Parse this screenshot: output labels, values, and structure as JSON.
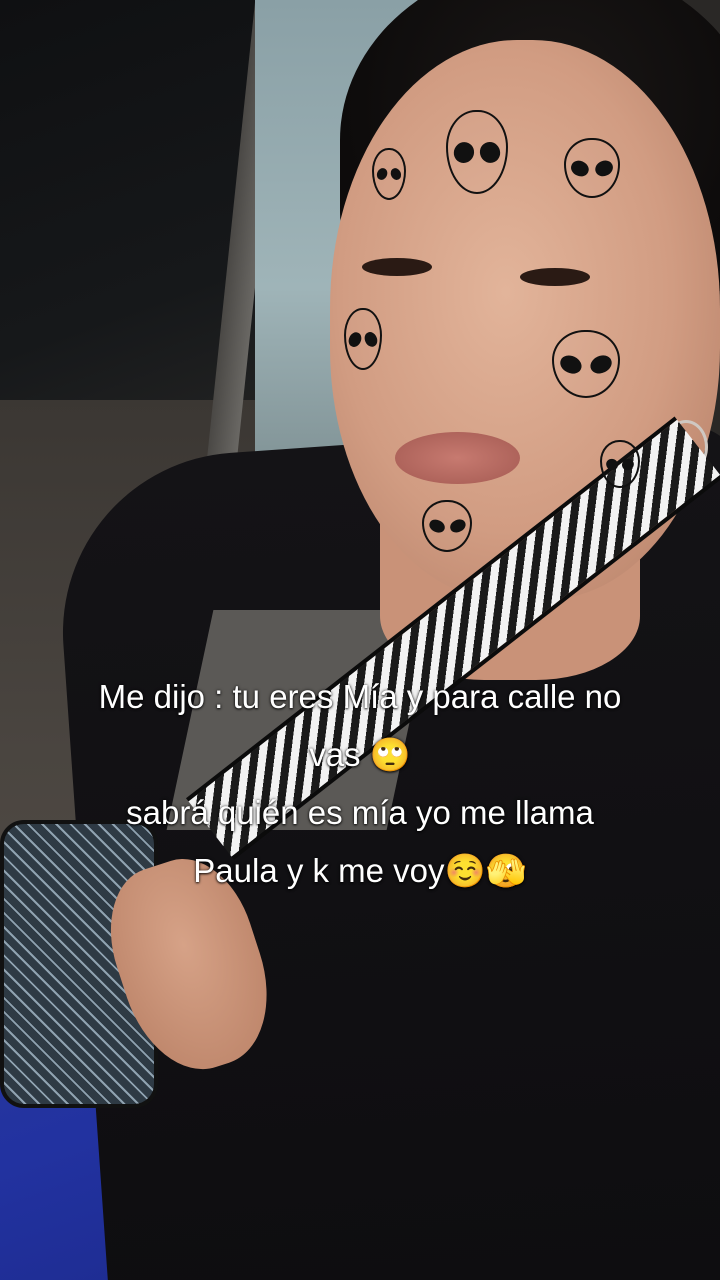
{
  "caption": {
    "line1": "Me dijo : tu eres Mía y para calle no",
    "line2": "vas 🙄",
    "line3": "sabrá quién es mía yo me llama",
    "line4": "Paula y k me voy☺️🫣"
  },
  "stickers": {
    "icon": "alien-face-icon",
    "count": 8
  },
  "colors": {
    "caption_text": "#ffffff",
    "sticker_outline": "#111111",
    "skirt": "#2232a0",
    "jacket": "#141316"
  }
}
